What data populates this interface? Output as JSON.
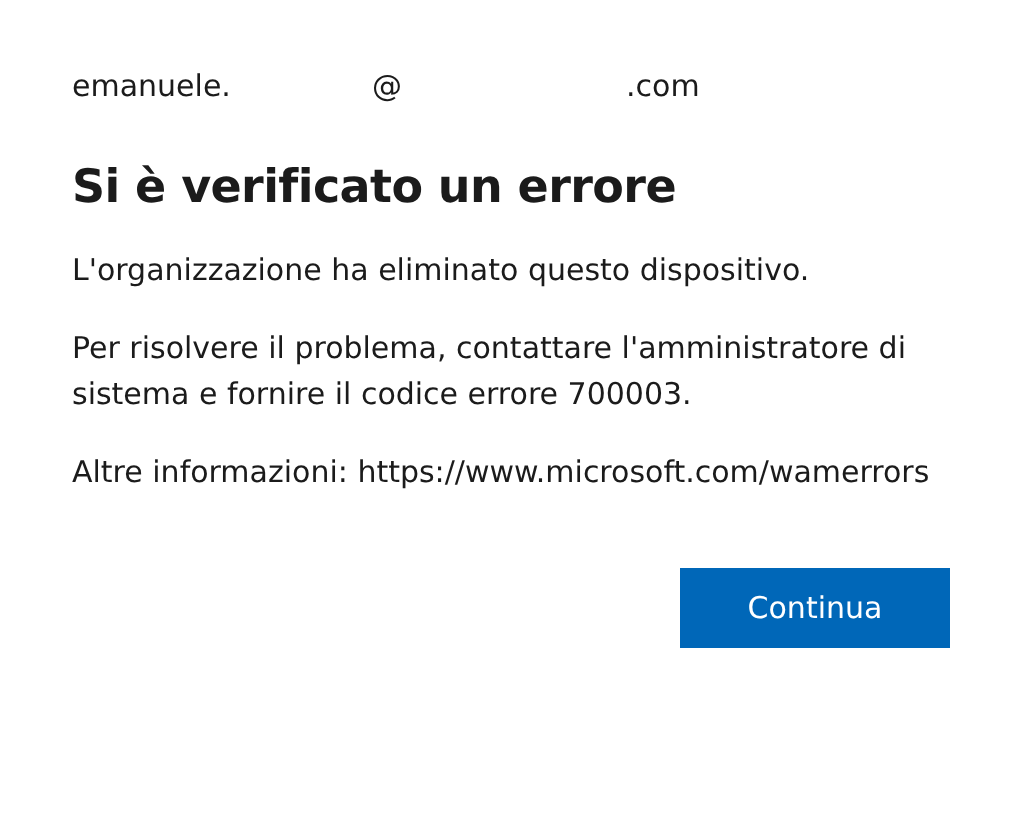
{
  "account": {
    "parts": [
      "emanuele.",
      "@",
      ".com"
    ]
  },
  "title": "Si è verificato un errore",
  "paragraphs": [
    "L'organizzazione ha eliminato questo dispositivo.",
    "Per risolvere il problema, contattare l'amministratore di sistema e fornire il codice errore 700003.",
    "Altre informazioni: https://www.microsoft.com/wamerrors"
  ],
  "buttons": [
    "Continua"
  ]
}
